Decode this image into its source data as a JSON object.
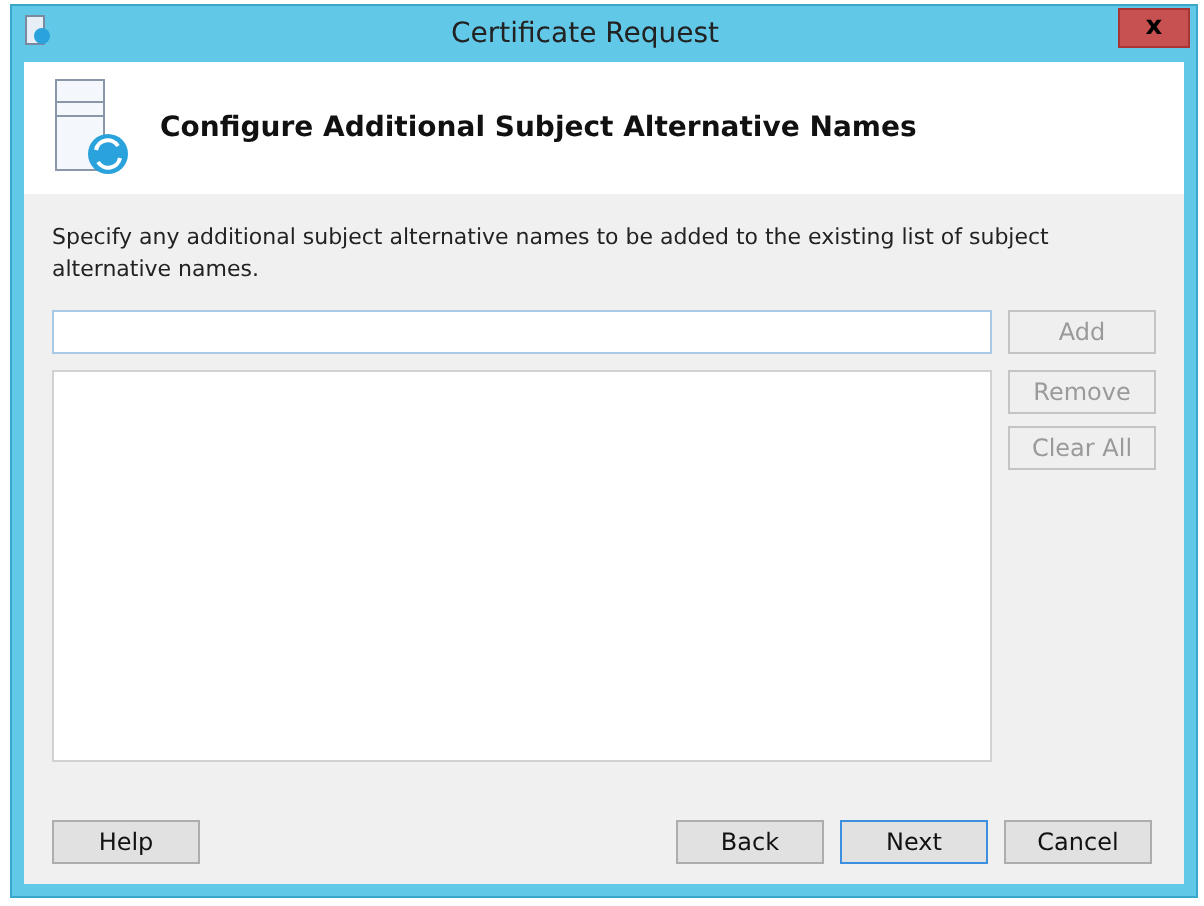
{
  "window": {
    "title": "Certificate Request",
    "close": "x"
  },
  "header": {
    "title": "Configure Additional Subject Alternative Names"
  },
  "description": "Specify any additional subject alternative names to be added to the existing list of subject alternative names.",
  "side_buttons": [
    {
      "label": "Add",
      "disabled": true
    },
    {
      "label": "Remove",
      "disabled": true
    },
    {
      "label": "Clear All",
      "disabled": true
    }
  ],
  "footer_left_buttons": [
    {
      "label": "Help",
      "default": false
    }
  ],
  "footer_right_buttons": [
    {
      "label": "Back",
      "default": false
    },
    {
      "label": "Next",
      "default": true
    },
    {
      "label": "Cancel",
      "default": false
    }
  ]
}
